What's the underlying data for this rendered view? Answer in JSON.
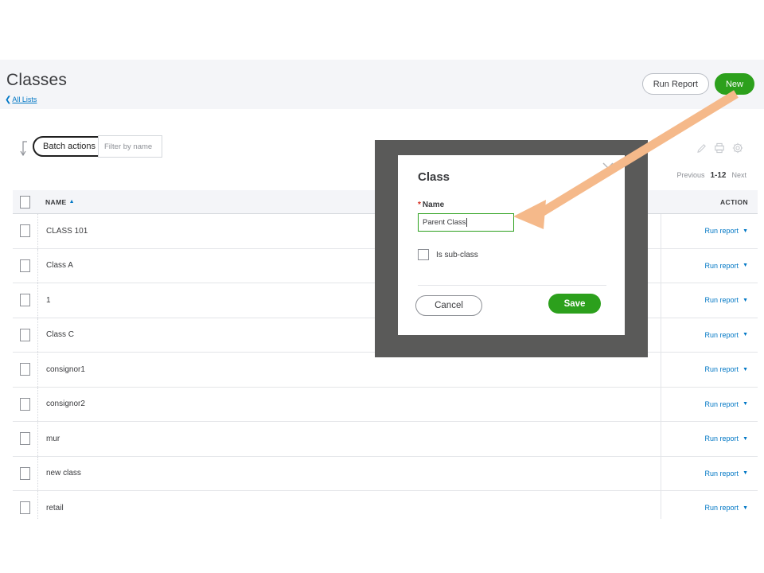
{
  "header": {
    "title": "Classes",
    "breadcrumb_chevron": "chevron-left-icon",
    "breadcrumb_label": "All Lists",
    "run_report_label": "Run Report",
    "new_label": "New"
  },
  "toolbar": {
    "sort_icon": "sort-arrow-icon",
    "batch_actions_label": "Batch actions",
    "batch_actions_caret": "▼",
    "filter_placeholder": "Filter by name",
    "filter_value": "",
    "icons": [
      "pencil-icon",
      "printer-icon",
      "gear-icon"
    ],
    "pagination": {
      "previous_label": "Previous",
      "range_label": "1-12",
      "next_label": "Next"
    }
  },
  "table": {
    "columns": {
      "name": "NAME",
      "sort_indicator": "▲",
      "action": "ACTION"
    },
    "action_link_label": "Run report",
    "action_caret": "▼",
    "rows": [
      {
        "name": "CLASS 101"
      },
      {
        "name": "Class A"
      },
      {
        "name": "1"
      },
      {
        "name": "Class C"
      },
      {
        "name": "consignor1"
      },
      {
        "name": "consignor2"
      },
      {
        "name": "mur"
      },
      {
        "name": "new class"
      },
      {
        "name": "retail"
      }
    ]
  },
  "modal": {
    "title": "Class",
    "close_icon": "close-icon",
    "name_required_marker": "*",
    "name_label": "Name",
    "name_value": "Parent Class",
    "name_placeholder": "",
    "sub_class_label": "Is sub-class",
    "sub_class_checked": false,
    "cancel_label": "Cancel",
    "save_label": "Save"
  },
  "annotation": {
    "arrow_name": "callout-arrow",
    "arrow_color": "#f5b98a"
  },
  "colors": {
    "brand_green": "#2ca01c",
    "link_blue": "#0077c5",
    "header_band": "#f4f5f8",
    "modal_backdrop": "#5a5a59",
    "required_red": "#d52b1e",
    "focus_border_green": "#2ca01c"
  }
}
